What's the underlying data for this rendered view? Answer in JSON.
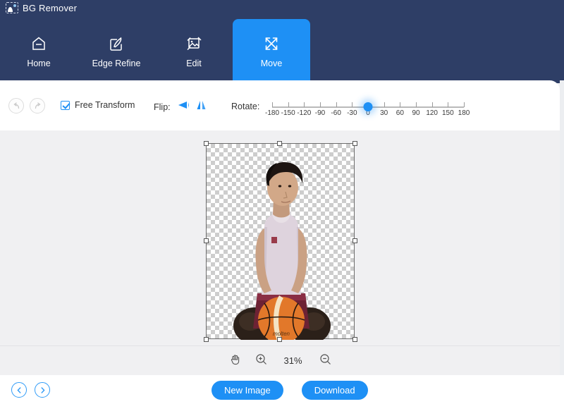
{
  "app": {
    "title": "BG Remover",
    "logo_icon": "image-placeholder-icon"
  },
  "nav": {
    "items": [
      {
        "label": "Home",
        "icon": "home-icon",
        "active": false
      },
      {
        "label": "Edge Refine",
        "icon": "pen-square-icon",
        "active": false
      },
      {
        "label": "Edit",
        "icon": "image-crop-icon",
        "active": false
      },
      {
        "label": "Move",
        "icon": "move-arrows-icon",
        "active": true
      }
    ]
  },
  "toolbar": {
    "undo_icon": "undo-arrow-icon",
    "redo_icon": "redo-arrow-icon",
    "free_transform_label": "Free Transform",
    "free_transform_checked": true,
    "flip_label": "Flip:",
    "flip_horizontal_icon": "flip-horizontal-icon",
    "flip_vertical_icon": "flip-vertical-icon",
    "rotate_label": "Rotate:",
    "rotate_value": 0,
    "rotate_ticks": [
      "-180",
      "-150",
      "-120",
      "-90",
      "-60",
      "-30",
      "0",
      "30",
      "60",
      "90",
      "120",
      "150",
      "180"
    ],
    "rotate_min": -180,
    "rotate_max": 180
  },
  "canvas": {
    "selection": {
      "handles": 8,
      "transparent_background": true
    },
    "subject_description": "young man in white tank top and maroon shorts holding an orange basketball"
  },
  "zoombar": {
    "hand_icon": "hand-pan-icon",
    "zoom_in_icon": "zoom-in-icon",
    "zoom_out_icon": "zoom-out-icon",
    "zoom_level": "31%"
  },
  "bottombar": {
    "prev_icon": "chevron-left-icon",
    "next_icon": "chevron-right-icon",
    "new_image_label": "New Image",
    "download_label": "Download"
  },
  "colors": {
    "header_bg": "#2e3e66",
    "accent": "#1e90f5",
    "canvas_bg": "#f0f0f2",
    "panel_bg": "#ffffff"
  }
}
